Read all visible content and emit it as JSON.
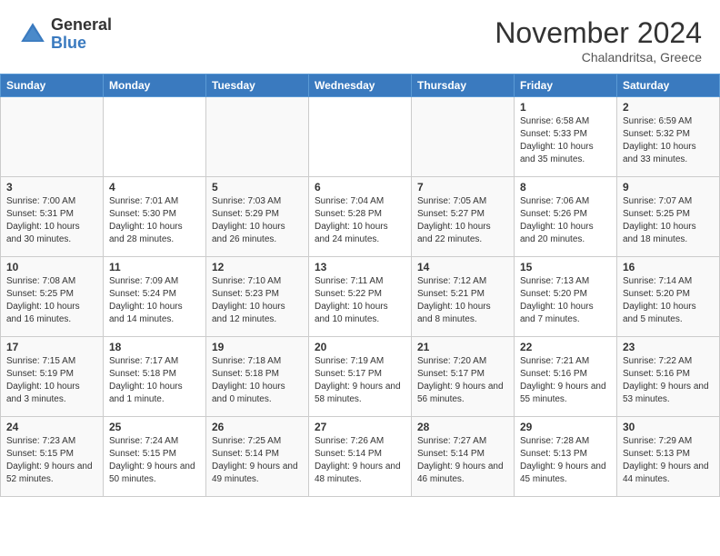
{
  "header": {
    "logo_general": "General",
    "logo_blue": "Blue",
    "month_title": "November 2024",
    "subtitle": "Chalandritsa, Greece"
  },
  "calendar": {
    "days_of_week": [
      "Sunday",
      "Monday",
      "Tuesday",
      "Wednesday",
      "Thursday",
      "Friday",
      "Saturday"
    ],
    "weeks": [
      [
        {
          "date": "",
          "info": ""
        },
        {
          "date": "",
          "info": ""
        },
        {
          "date": "",
          "info": ""
        },
        {
          "date": "",
          "info": ""
        },
        {
          "date": "",
          "info": ""
        },
        {
          "date": "1",
          "info": "Sunrise: 6:58 AM\nSunset: 5:33 PM\nDaylight: 10 hours and 35 minutes."
        },
        {
          "date": "2",
          "info": "Sunrise: 6:59 AM\nSunset: 5:32 PM\nDaylight: 10 hours and 33 minutes."
        }
      ],
      [
        {
          "date": "3",
          "info": "Sunrise: 7:00 AM\nSunset: 5:31 PM\nDaylight: 10 hours and 30 minutes."
        },
        {
          "date": "4",
          "info": "Sunrise: 7:01 AM\nSunset: 5:30 PM\nDaylight: 10 hours and 28 minutes."
        },
        {
          "date": "5",
          "info": "Sunrise: 7:03 AM\nSunset: 5:29 PM\nDaylight: 10 hours and 26 minutes."
        },
        {
          "date": "6",
          "info": "Sunrise: 7:04 AM\nSunset: 5:28 PM\nDaylight: 10 hours and 24 minutes."
        },
        {
          "date": "7",
          "info": "Sunrise: 7:05 AM\nSunset: 5:27 PM\nDaylight: 10 hours and 22 minutes."
        },
        {
          "date": "8",
          "info": "Sunrise: 7:06 AM\nSunset: 5:26 PM\nDaylight: 10 hours and 20 minutes."
        },
        {
          "date": "9",
          "info": "Sunrise: 7:07 AM\nSunset: 5:25 PM\nDaylight: 10 hours and 18 minutes."
        }
      ],
      [
        {
          "date": "10",
          "info": "Sunrise: 7:08 AM\nSunset: 5:25 PM\nDaylight: 10 hours and 16 minutes."
        },
        {
          "date": "11",
          "info": "Sunrise: 7:09 AM\nSunset: 5:24 PM\nDaylight: 10 hours and 14 minutes."
        },
        {
          "date": "12",
          "info": "Sunrise: 7:10 AM\nSunset: 5:23 PM\nDaylight: 10 hours and 12 minutes."
        },
        {
          "date": "13",
          "info": "Sunrise: 7:11 AM\nSunset: 5:22 PM\nDaylight: 10 hours and 10 minutes."
        },
        {
          "date": "14",
          "info": "Sunrise: 7:12 AM\nSunset: 5:21 PM\nDaylight: 10 hours and 8 minutes."
        },
        {
          "date": "15",
          "info": "Sunrise: 7:13 AM\nSunset: 5:20 PM\nDaylight: 10 hours and 7 minutes."
        },
        {
          "date": "16",
          "info": "Sunrise: 7:14 AM\nSunset: 5:20 PM\nDaylight: 10 hours and 5 minutes."
        }
      ],
      [
        {
          "date": "17",
          "info": "Sunrise: 7:15 AM\nSunset: 5:19 PM\nDaylight: 10 hours and 3 minutes."
        },
        {
          "date": "18",
          "info": "Sunrise: 7:17 AM\nSunset: 5:18 PM\nDaylight: 10 hours and 1 minute."
        },
        {
          "date": "19",
          "info": "Sunrise: 7:18 AM\nSunset: 5:18 PM\nDaylight: 10 hours and 0 minutes."
        },
        {
          "date": "20",
          "info": "Sunrise: 7:19 AM\nSunset: 5:17 PM\nDaylight: 9 hours and 58 minutes."
        },
        {
          "date": "21",
          "info": "Sunrise: 7:20 AM\nSunset: 5:17 PM\nDaylight: 9 hours and 56 minutes."
        },
        {
          "date": "22",
          "info": "Sunrise: 7:21 AM\nSunset: 5:16 PM\nDaylight: 9 hours and 55 minutes."
        },
        {
          "date": "23",
          "info": "Sunrise: 7:22 AM\nSunset: 5:16 PM\nDaylight: 9 hours and 53 minutes."
        }
      ],
      [
        {
          "date": "24",
          "info": "Sunrise: 7:23 AM\nSunset: 5:15 PM\nDaylight: 9 hours and 52 minutes."
        },
        {
          "date": "25",
          "info": "Sunrise: 7:24 AM\nSunset: 5:15 PM\nDaylight: 9 hours and 50 minutes."
        },
        {
          "date": "26",
          "info": "Sunrise: 7:25 AM\nSunset: 5:14 PM\nDaylight: 9 hours and 49 minutes."
        },
        {
          "date": "27",
          "info": "Sunrise: 7:26 AM\nSunset: 5:14 PM\nDaylight: 9 hours and 48 minutes."
        },
        {
          "date": "28",
          "info": "Sunrise: 7:27 AM\nSunset: 5:14 PM\nDaylight: 9 hours and 46 minutes."
        },
        {
          "date": "29",
          "info": "Sunrise: 7:28 AM\nSunset: 5:13 PM\nDaylight: 9 hours and 45 minutes."
        },
        {
          "date": "30",
          "info": "Sunrise: 7:29 AM\nSunset: 5:13 PM\nDaylight: 9 hours and 44 minutes."
        }
      ]
    ]
  }
}
